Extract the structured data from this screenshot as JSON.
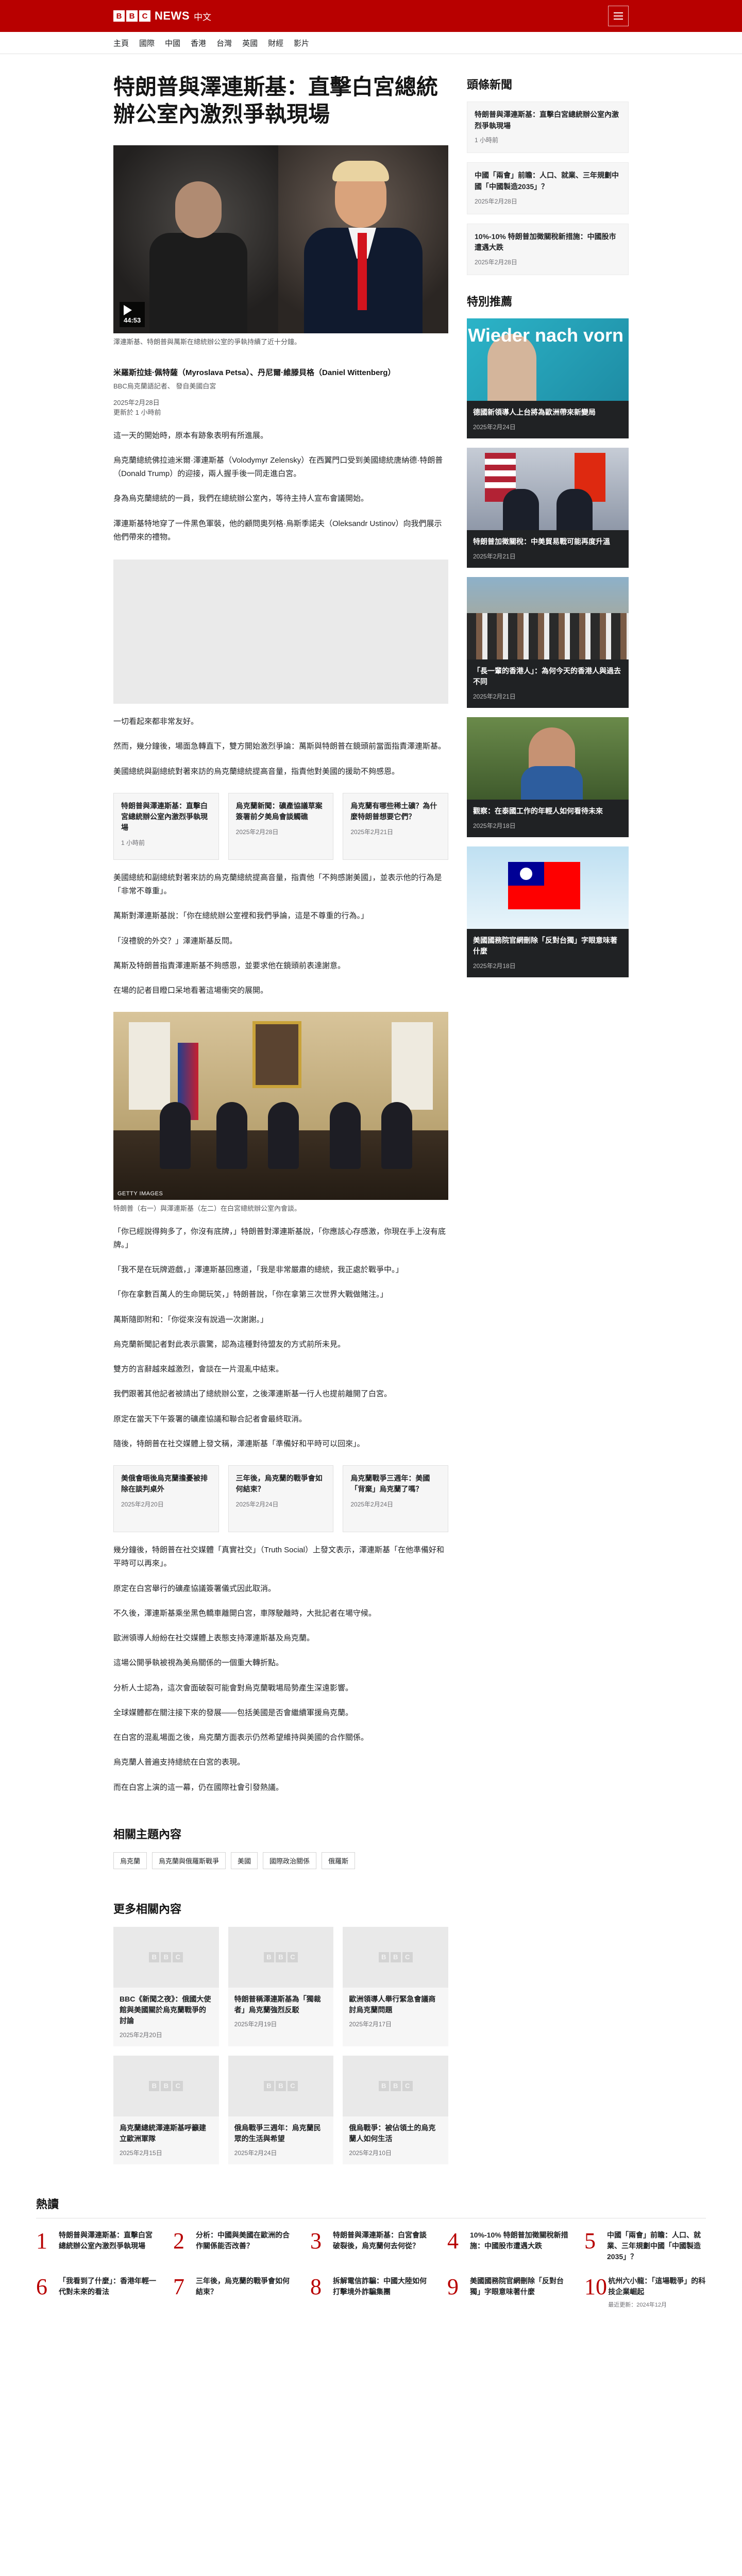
{
  "header": {
    "logo_letters": [
      "B",
      "B",
      "C"
    ],
    "brand_news": "NEWS",
    "brand_lang": "中文",
    "menu_label": "菜單",
    "nav": [
      "主頁",
      "國際",
      "中國",
      "香港",
      "台灣",
      "英國",
      "財經",
      "影片"
    ]
  },
  "article": {
    "title": "特朗普與澤連斯基：直擊白宮總統辦公室內激烈爭執現場",
    "hero": {
      "duration": "44:53",
      "caption": "澤連斯基、特朗普與萬斯在總統辦公室的爭執持續了近十分鐘。"
    },
    "byline": {
      "names": "米羅斯拉娃·佩特薩（Myroslava Petsa）、丹尼爾·維滕貝格（Daniel Wittenberg）",
      "org": "BBC烏克蘭語記者、 發自美國白宮",
      "date": "2025年2月28日",
      "updated": "更新於 1 小時前"
    },
    "paras1": [
      "這一天的開始時，原本有跡象表明有所進展。",
      "烏克蘭總統佛拉迪米爾·澤連斯基（Volodymyr Zelensky）在西翼門口受到美國總統唐納德·特朗普（Donald Trump）的迎接，兩人握手後一同走進白宮。",
      "身為烏克蘭總統的一員，我們在總統辦公室內，等待主持人宣布會議開始。",
      "澤連斯基特地穿了一件黑色軍裝，他的顧問奧列格·烏斯季諾夫（Oleksandr Ustinov）向我們展示他們帶來的禮物。"
    ],
    "paras2": [
      "一切看起來都非常友好。",
      "然而，幾分鐘後，場面急轉直下，雙方開始激烈爭論：萬斯與特朗普在鏡頭前當面指責澤連斯基。",
      "美國總統與副總統對著來訪的烏克蘭總統提高音量，指責他對美國的援助不夠感恩。"
    ],
    "related_inline": [
      {
        "title": "特朗普與澤連斯基：直擊白宮總統辦公室內激烈爭執現場",
        "date": "1 小時前"
      },
      {
        "title": "烏克蘭新聞：礦產協議草案簽署前夕美烏會談觸礁",
        "date": "2025年2月28日"
      },
      {
        "title": "烏克蘭有哪些稀土礦？為什麼特朗普想要它們？",
        "date": "2025年2月21日"
      }
    ],
    "paras3": [
      "美國總統和副總統對著來訪的烏克蘭總統提高音量，指責他「不夠感謝美國」，並表示他的行為是「非常不尊重」。",
      "萬斯對澤連斯基說：「你在總統辦公室裡和我們爭論，這是不尊重的行為。」",
      "「沒禮貌的外交？」澤連斯基反問。",
      "萬斯及特朗普指責澤連斯基不夠感恩，並要求他在鏡頭前表達謝意。",
      "在場的記者目瞪口呆地看著這場衝突的展開。"
    ],
    "photo2_credit": "GETTY IMAGES",
    "photo2_caption": "特朗普（右一）與澤連斯基（左二）在白宮總統辦公室內會談。",
    "paras4": [
      "「你已經說得夠多了，你沒有底牌，」特朗普對澤連斯基說，「你應該心存感激，你現在手上沒有底牌。」",
      "「我不是在玩牌遊戲，」澤連斯基回應道，「我是非常嚴肅的總統，我正處於戰爭中。」",
      "「你在拿數百萬人的生命開玩笑，」特朗普說，「你在拿第三次世界大戰做賭注。」",
      "萬斯隨即附和：「你從來沒有說過一次謝謝。」",
      "烏克蘭新聞記者對此表示震驚，認為這種對待盟友的方式前所未見。",
      "雙方的言辭越來越激烈，會談在一片混亂中結束。",
      "我們跟著其他記者被請出了總統辦公室，之後澤連斯基一行人也提前離開了白宮。",
      "原定在當天下午簽署的礦產協議和聯合記者會最終取消。",
      "隨後，特朗普在社交媒體上發文稱，澤連斯基「準備好和平時可以回來」。"
    ],
    "related_inline2": [
      {
        "title": "美俄會晤後烏克蘭擔憂被排除在談判桌外",
        "date": "2025年2月20日"
      },
      {
        "title": "三年後，烏克蘭的戰爭會如何結束？",
        "date": "2025年2月24日"
      },
      {
        "title": "烏克蘭戰爭三週年：美國「背棄」烏克蘭了嗎？",
        "date": "2025年2月24日"
      }
    ],
    "paras5": [
      "幾分鐘後，特朗普在社交媒體「真實社交」（Truth Social）上發文表示，澤連斯基「在他準備好和平時可以再來」。",
      "原定在白宮舉行的礦產協議簽署儀式因此取消。",
      "不久後，澤連斯基乘坐黑色轎車離開白宮，車隊駛離時，大批記者在場守候。",
      "歐洲領導人紛紛在社交媒體上表態支持澤連斯基及烏克蘭。",
      "這場公開爭執被視為美烏關係的一個重大轉折點。",
      "分析人士認為，這次會面破裂可能會對烏克蘭戰場局勢產生深遠影響。",
      "全球媒體都在關注接下來的發展——包括美國是否會繼續軍援烏克蘭。",
      "在白宮的混亂場面之後，烏克蘭方面表示仍然希望維持與美國的合作關係。",
      "烏克蘭人普遍支持總統在白宮的表現。",
      "而在白宮上演的這一幕，仍在國際社會引發熱議。"
    ],
    "related_topics_title": "相關主題內容",
    "topics": [
      "烏克蘭",
      "烏克蘭與俄羅斯戰爭",
      "美國",
      "國際政治關係",
      "俄羅斯"
    ],
    "more_title": "更多相關內容",
    "more": [
      {
        "title": "BBC《新聞之夜》：俄國大使館與美國關於烏克蘭戰爭的討論",
        "date": "2025年2月20日"
      },
      {
        "title": "特朗普稱澤連斯基為「獨裁者」烏克蘭強烈反駁",
        "date": "2025年2月19日"
      },
      {
        "title": "歐洲領導人舉行緊急會議商討烏克蘭問題",
        "date": "2025年2月17日"
      },
      {
        "title": "烏克蘭總統澤連斯基呼籲建立歐洲軍隊",
        "date": "2025年2月15日"
      },
      {
        "title": "俄烏戰爭三週年：烏克蘭民眾的生活與希望",
        "date": "2025年2月24日"
      },
      {
        "title": "俄烏戰爭：被佔領土的烏克蘭人如何生活",
        "date": "2025年2月10日"
      }
    ]
  },
  "sidebar": {
    "top_title": "頭條新聞",
    "top": [
      {
        "title": "特朗普與澤連斯基：直擊白宮總統辦公室內激烈爭執現場",
        "date": "1 小時前"
      },
      {
        "title": "中國「兩會」前瞻：人口、就業、三年規劃中國「中國製造2035」？",
        "date": "2025年2月28日"
      },
      {
        "title": "10%-10% 特朗普加徵關稅新措施：中國股市遭遇大跌",
        "date": "2025年2月28日"
      }
    ],
    "featured_title": "特別推薦",
    "featured_banner": "Wieder nach vorn",
    "featured": [
      {
        "title": "德國新領導人上台將為歐洲帶來新變局",
        "date": "2025年2月24日"
      },
      {
        "title": "特朗普加徵關稅：中美貿易戰可能再度升溫",
        "date": "2025年2月21日"
      },
      {
        "title": "「長一輩的香港人」：為何今天的香港人與過去不同",
        "date": "2025年2月21日"
      },
      {
        "title": "觀察：在泰國工作的年輕人如何看待未來",
        "date": "2025年2月18日"
      },
      {
        "title": "美國國務院官網刪除「反對台獨」字眼意味著什麼",
        "date": "2025年2月18日"
      }
    ]
  },
  "popular": {
    "title": "熱讀",
    "items": [
      {
        "num": "1",
        "title": "特朗普與澤連斯基：直擊白宮總統辦公室內激烈爭執現場",
        "date": ""
      },
      {
        "num": "2",
        "title": "分析：中國與美國在歐洲的合作關係能否改善？",
        "date": ""
      },
      {
        "num": "3",
        "title": "特朗普與澤連斯基：白宮會談破裂後，烏克蘭何去何從？",
        "date": ""
      },
      {
        "num": "4",
        "title": "10%-10% 特朗普加徵關稅新措施：中國股市遭遇大跌",
        "date": ""
      },
      {
        "num": "5",
        "title": "中國「兩會」前瞻：人口、就業、三年規劃中國「中國製造2035」？",
        "date": ""
      },
      {
        "num": "6",
        "title": "「我看到了什麼」：香港年輕一代對未來的看法",
        "date": ""
      },
      {
        "num": "7",
        "title": "三年後，烏克蘭的戰爭會如何結束？",
        "date": ""
      },
      {
        "num": "8",
        "title": "拆解電信詐騙：中國大陸如何打擊境外詐騙集團",
        "date": ""
      },
      {
        "num": "9",
        "title": "美國國務院官網刪除「反對台獨」字眼意味著什麼",
        "date": ""
      },
      {
        "num": "10",
        "title": "杭州六小龍：「這場戰爭」的科技企業崛起",
        "date": "最近更新：2024年12月"
      }
    ]
  }
}
